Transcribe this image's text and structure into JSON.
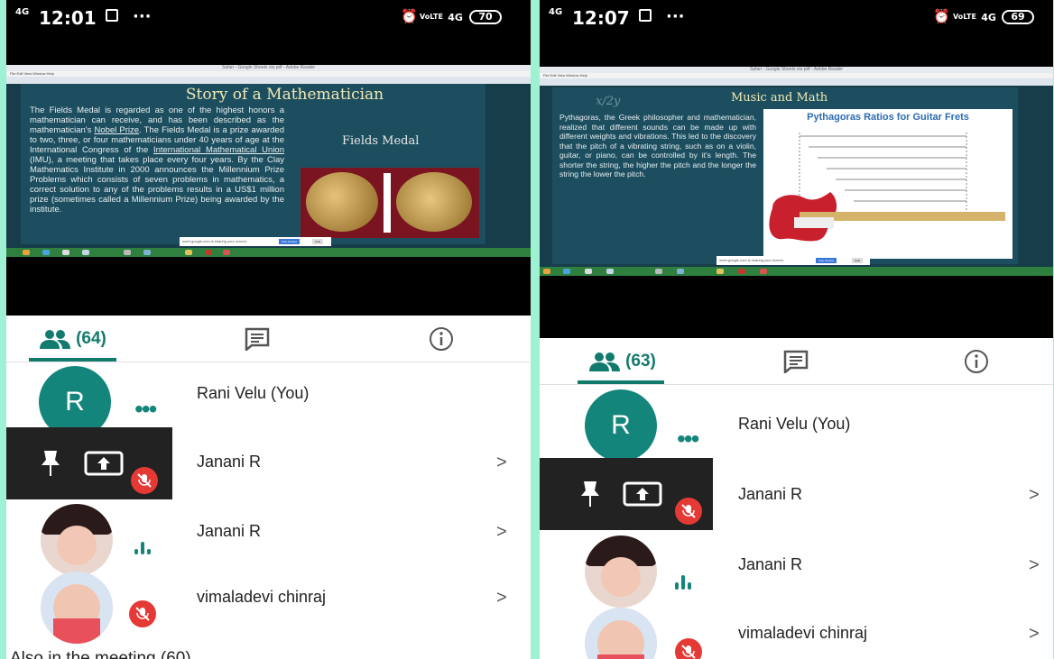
{
  "left": {
    "status": {
      "network": "4G",
      "time": "12:01",
      "dots": "···",
      "volte": "VoLTE",
      "lte_4g": "4G",
      "battery": "70"
    },
    "slide": {
      "window_title": "Safari - Google Sheets via pdf - Adobe Reader",
      "menu": "File Edit View Window Help",
      "title": "Story of a Mathematician",
      "body_before_link1": "The Fields Medal is regarded as one of the highest honors a mathematician can receive, and has been described as the mathematician's ",
      "link1": "Nobel Prize",
      "body_middle": ". The Fields Medal is a prize awarded to two, three, or four mathematicians under 40 years of age at the International Congress of the ",
      "link2": "International Mathematical Union",
      "body_after": " (IMU), a meeting that takes place every four years. By the Clay Mathematics Institute in 2000 announces the Millennium Prize Problems which consists of seven problems in mathematics, a correct solution to any of the problems results in a US$1 million prize (sometimes called a Millennium Prize) being awarded by the institute.",
      "side_label": "Fields Medal",
      "share_text": "meet.google.com is sharing your screen.",
      "share_button": "Stop sharing",
      "hide": "Hide"
    },
    "tabs": {
      "people_count": "(64)"
    },
    "participants": [
      {
        "name": "Rani Velu (You)",
        "avatar": "R"
      },
      {
        "name": "Janani R",
        "chevron": ">"
      },
      {
        "name": "Janani R",
        "chevron": ">"
      },
      {
        "name": "vimaladevi chinraj",
        "chevron": ">"
      }
    ],
    "also": "Also in the meeting (60)"
  },
  "right": {
    "status": {
      "network": "4G",
      "time": "12:07",
      "dots": "···",
      "volte": "VoLTE",
      "lte_4g": "4G",
      "battery": "69"
    },
    "slide": {
      "window_title": "Safari - Google Sheets via pdf - Adobe Reader",
      "menu": "File Edit View Window Help",
      "title": "Music and Math",
      "formula": "x/2y",
      "body": "Pythagoras, the Greek philosopher and mathematician, realized that different sounds can be made up with different weights and vibrations. This led to the discovery that the pitch of a vibrating string, such as on a violin, guitar, or piano, can be controlled by it's length. The shorter the string, the higher the pitch and the longer the string the lower the pitch.",
      "image_title": "Pythagoras Ratios for Guitar Frets",
      "share_text": "meet.google.com is sharing your screen.",
      "share_button": "Stop sharing",
      "hide": "Hide"
    },
    "tabs": {
      "people_count": "(63)"
    },
    "participants": [
      {
        "name": "Rani Velu (You)",
        "avatar": "R"
      },
      {
        "name": "Janani R",
        "chevron": ">"
      },
      {
        "name": "Janani R",
        "chevron": ">"
      },
      {
        "name": "vimaladevi chinraj",
        "chevron": ">"
      }
    ]
  },
  "colors": {
    "accent": "#137a6e",
    "mute": "#e53935",
    "background": "#9ef2d3",
    "slide": "#1d4e5f"
  },
  "icons": [
    "people-icon",
    "chat-icon",
    "info-icon",
    "pin-icon",
    "present-icon",
    "mic-off-icon",
    "more-dots-icon",
    "speaking-icon",
    "chevron-right-icon"
  ]
}
